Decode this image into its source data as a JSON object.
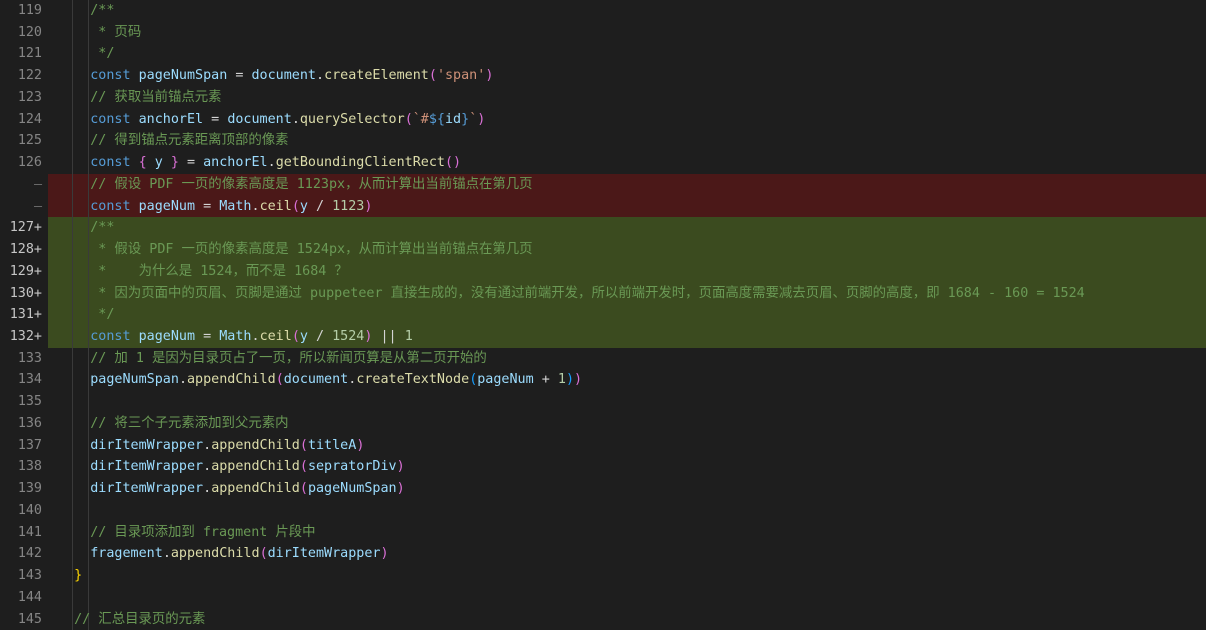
{
  "lines": [
    {
      "no": "119",
      "kind": "",
      "tokens": [
        [
          "cmt",
          "    /**"
        ]
      ]
    },
    {
      "no": "120",
      "kind": "",
      "tokens": [
        [
          "cmt",
          "     * 页码"
        ]
      ]
    },
    {
      "no": "121",
      "kind": "",
      "tokens": [
        [
          "cmt",
          "     */"
        ]
      ]
    },
    {
      "no": "122",
      "kind": "",
      "tokens": [
        [
          "kw",
          "    const "
        ],
        [
          "var",
          "pageNumSpan"
        ],
        [
          "op",
          " = "
        ],
        [
          "var",
          "document"
        ],
        [
          "op",
          "."
        ],
        [
          "fn",
          "createElement"
        ],
        [
          "br2",
          "("
        ],
        [
          "str",
          "'span'"
        ],
        [
          "br2",
          ")"
        ]
      ]
    },
    {
      "no": "123",
      "kind": "",
      "tokens": [
        [
          "cmt",
          "    // 获取当前锚点元素"
        ]
      ]
    },
    {
      "no": "124",
      "kind": "",
      "tokens": [
        [
          "kw",
          "    const "
        ],
        [
          "var",
          "anchorEl"
        ],
        [
          "op",
          " = "
        ],
        [
          "var",
          "document"
        ],
        [
          "op",
          "."
        ],
        [
          "fn",
          "querySelector"
        ],
        [
          "br2",
          "("
        ],
        [
          "str",
          "`#"
        ],
        [
          "kw",
          "${"
        ],
        [
          "var",
          "id"
        ],
        [
          "kw",
          "}"
        ],
        [
          "str",
          "`"
        ],
        [
          "br2",
          ")"
        ]
      ]
    },
    {
      "no": "125",
      "kind": "",
      "tokens": [
        [
          "cmt",
          "    // 得到锚点元素距离顶部的像素"
        ]
      ]
    },
    {
      "no": "126",
      "kind": "",
      "tokens": [
        [
          "kw",
          "    const "
        ],
        [
          "br2",
          "{"
        ],
        [
          "var",
          " y "
        ],
        [
          "br2",
          "}"
        ],
        [
          "op",
          " = "
        ],
        [
          "var",
          "anchorEl"
        ],
        [
          "op",
          "."
        ],
        [
          "fn",
          "getBoundingClientRect"
        ],
        [
          "br2",
          "()"
        ]
      ]
    },
    {
      "no": "—",
      "kind": "del",
      "tokens": [
        [
          "cmt",
          "    // 假设 PDF 一页的像素高度是 1123px，从而计算出当前锚点在第几页"
        ]
      ]
    },
    {
      "no": "—",
      "kind": "del",
      "tokens": [
        [
          "kw",
          "    const "
        ],
        [
          "var",
          "pageNum"
        ],
        [
          "op",
          " = "
        ],
        [
          "var",
          "Math"
        ],
        [
          "op",
          "."
        ],
        [
          "fn",
          "ceil"
        ],
        [
          "br2",
          "("
        ],
        [
          "var",
          "y"
        ],
        [
          "op",
          " / "
        ],
        [
          "num",
          "1123"
        ],
        [
          "br2",
          ")"
        ]
      ]
    },
    {
      "no": "127+",
      "kind": "add",
      "tokens": [
        [
          "cmt",
          "    /**"
        ]
      ]
    },
    {
      "no": "128+",
      "kind": "add",
      "tokens": [
        [
          "cmt",
          "     * 假设 PDF 一页的像素高度是 1524px，从而计算出当前锚点在第几页"
        ]
      ]
    },
    {
      "no": "129+",
      "kind": "add",
      "tokens": [
        [
          "cmt",
          "     *    为什么是 1524，而不是 1684 ？"
        ]
      ]
    },
    {
      "no": "130+",
      "kind": "add",
      "tokens": [
        [
          "cmt",
          "     * 因为页面中的页眉、页脚是通过 puppeteer 直接生成的，没有通过前端开发，所以前端开发时，页面高度需要减去页眉、页脚的高度，即 1684 - 160 = 1524"
        ]
      ]
    },
    {
      "no": "131+",
      "kind": "add",
      "tokens": [
        [
          "cmt",
          "     */"
        ]
      ]
    },
    {
      "no": "132+",
      "kind": "add",
      "tokens": [
        [
          "kw",
          "    const "
        ],
        [
          "var",
          "pageNum"
        ],
        [
          "op",
          " = "
        ],
        [
          "var",
          "Math"
        ],
        [
          "op",
          "."
        ],
        [
          "fn",
          "ceil"
        ],
        [
          "br2",
          "("
        ],
        [
          "var",
          "y"
        ],
        [
          "op",
          " / "
        ],
        [
          "num",
          "1524"
        ],
        [
          "br2",
          ")"
        ],
        [
          "op",
          " || "
        ],
        [
          "num",
          "1"
        ]
      ]
    },
    {
      "no": "133",
      "kind": "",
      "tokens": [
        [
          "cmt",
          "    // 加 1 是因为目录页占了一页，所以新闻页算是从第二页开始的"
        ]
      ]
    },
    {
      "no": "134",
      "kind": "",
      "tokens": [
        [
          "var",
          "    pageNumSpan"
        ],
        [
          "op",
          "."
        ],
        [
          "fn",
          "appendChild"
        ],
        [
          "br2",
          "("
        ],
        [
          "var",
          "document"
        ],
        [
          "op",
          "."
        ],
        [
          "fn",
          "createTextNode"
        ],
        [
          "br3",
          "("
        ],
        [
          "var",
          "pageNum"
        ],
        [
          "op",
          " + "
        ],
        [
          "num",
          "1"
        ],
        [
          "br3",
          ")"
        ],
        [
          "br2",
          ")"
        ]
      ]
    },
    {
      "no": "135",
      "kind": "",
      "tokens": [
        [
          "op",
          " "
        ]
      ]
    },
    {
      "no": "136",
      "kind": "",
      "tokens": [
        [
          "cmt",
          "    // 将三个子元素添加到父元素内"
        ]
      ]
    },
    {
      "no": "137",
      "kind": "",
      "tokens": [
        [
          "var",
          "    dirItemWrapper"
        ],
        [
          "op",
          "."
        ],
        [
          "fn",
          "appendChild"
        ],
        [
          "br2",
          "("
        ],
        [
          "var",
          "titleA"
        ],
        [
          "br2",
          ")"
        ]
      ]
    },
    {
      "no": "138",
      "kind": "",
      "tokens": [
        [
          "var",
          "    dirItemWrapper"
        ],
        [
          "op",
          "."
        ],
        [
          "fn",
          "appendChild"
        ],
        [
          "br2",
          "("
        ],
        [
          "var",
          "sepratorDiv"
        ],
        [
          "br2",
          ")"
        ]
      ]
    },
    {
      "no": "139",
      "kind": "",
      "tokens": [
        [
          "var",
          "    dirItemWrapper"
        ],
        [
          "op",
          "."
        ],
        [
          "fn",
          "appendChild"
        ],
        [
          "br2",
          "("
        ],
        [
          "var",
          "pageNumSpan"
        ],
        [
          "br2",
          ")"
        ]
      ]
    },
    {
      "no": "140",
      "kind": "",
      "tokens": [
        [
          "op",
          " "
        ]
      ]
    },
    {
      "no": "141",
      "kind": "",
      "tokens": [
        [
          "cmt",
          "    // 目录项添加到 fragment 片段中"
        ]
      ]
    },
    {
      "no": "142",
      "kind": "",
      "tokens": [
        [
          "var",
          "    fragement"
        ],
        [
          "op",
          "."
        ],
        [
          "fn",
          "appendChild"
        ],
        [
          "br2",
          "("
        ],
        [
          "var",
          "dirItemWrapper"
        ],
        [
          "br2",
          ")"
        ]
      ]
    },
    {
      "no": "143",
      "kind": "",
      "tokens": [
        [
          "br1",
          "  }"
        ]
      ]
    },
    {
      "no": "144",
      "kind": "",
      "tokens": [
        [
          "op",
          " "
        ]
      ]
    },
    {
      "no": "145",
      "kind": "",
      "tokens": [
        [
          "cmt",
          "  // 汇总目录页的元素"
        ]
      ]
    }
  ]
}
